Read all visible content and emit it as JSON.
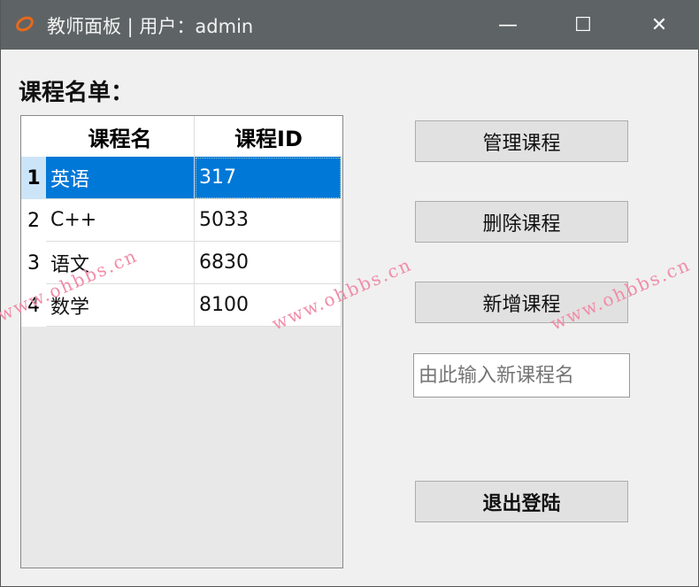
{
  "window": {
    "title": "教师面板 | 用户：admin",
    "minimize": "—",
    "maximize": "☐",
    "close": "✕"
  },
  "heading": "课程名单：",
  "table": {
    "columns": [
      "课程名",
      "课程ID"
    ],
    "rows": [
      {
        "index": "1",
        "name": "英语",
        "id": "317",
        "selected": true
      },
      {
        "index": "2",
        "name": "C++",
        "id": "5033"
      },
      {
        "index": "3",
        "name": "语文",
        "id": "6830"
      },
      {
        "index": "4",
        "name": "数学",
        "id": "8100"
      }
    ]
  },
  "buttons": {
    "manage": "管理课程",
    "delete": "删除课程",
    "add": "新增课程",
    "logout": "退出登陆"
  },
  "new_course_input": {
    "placeholder": "由此输入新课程名",
    "value": ""
  },
  "watermark": "www.ohbbs.cn",
  "colors": {
    "selection": "#0078d7",
    "titlebar": "#5e6465"
  }
}
